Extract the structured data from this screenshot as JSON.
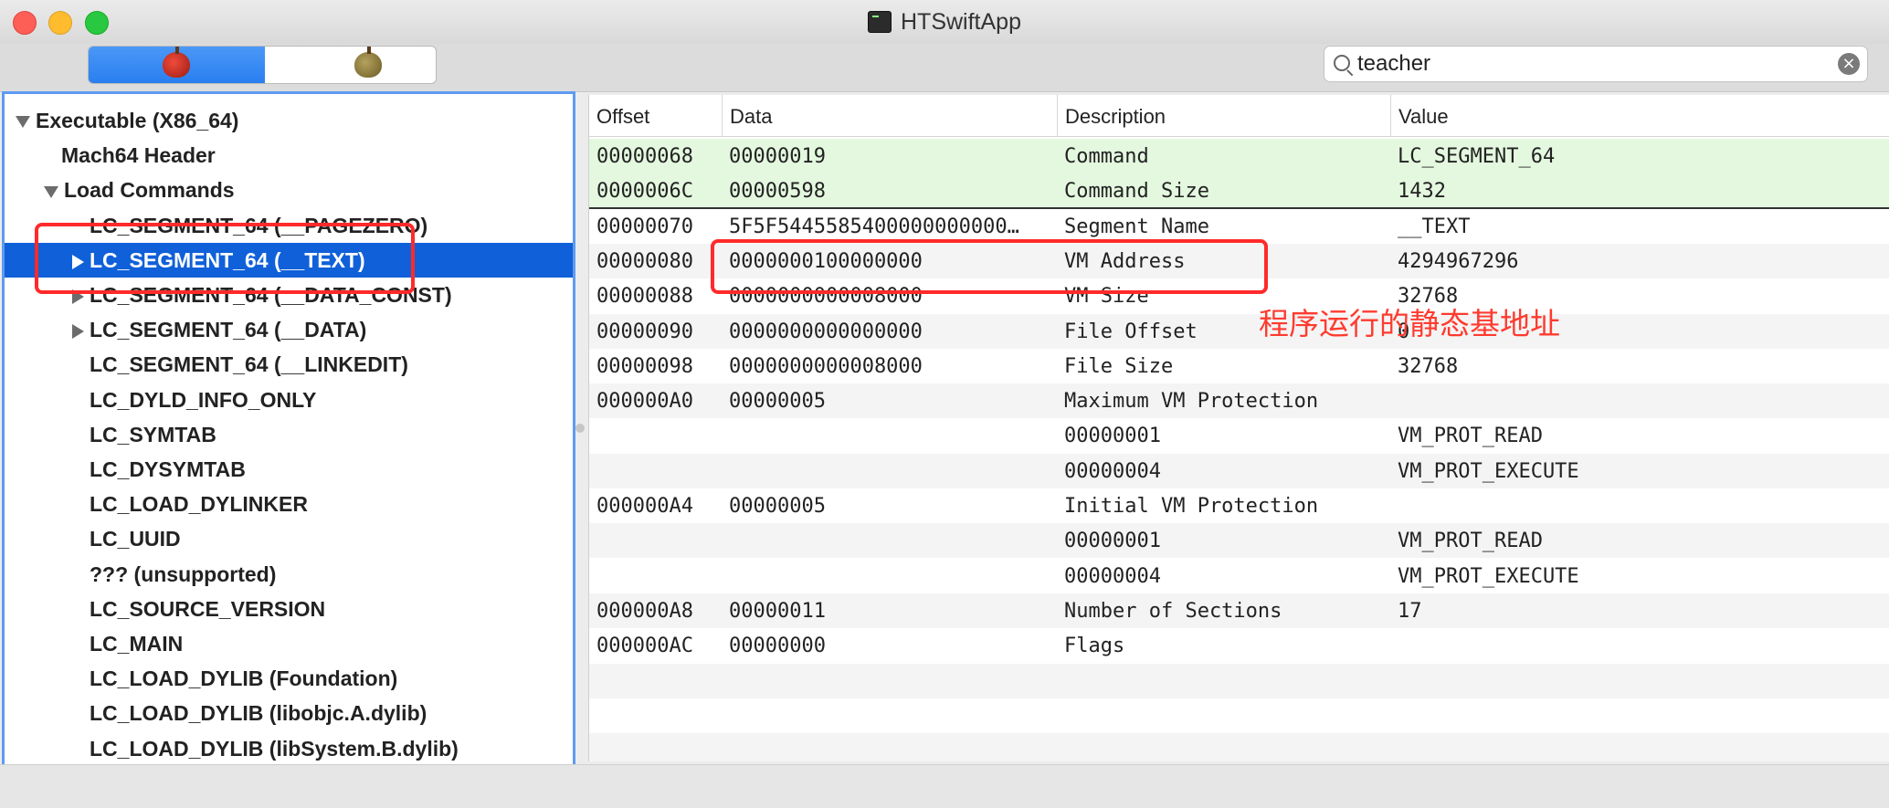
{
  "window": {
    "title": "HTSwiftApp"
  },
  "toolbar": {
    "search_value": "teacher",
    "clear_symbol": "×"
  },
  "tree": [
    {
      "label": "Executable  (X86_64)",
      "indent": 0,
      "disclosure": "down",
      "selected": false
    },
    {
      "label": "Mach64 Header",
      "indent": 1,
      "disclosure": "none",
      "selected": false
    },
    {
      "label": "Load Commands",
      "indent": 1,
      "disclosure": "down",
      "selected": false
    },
    {
      "label": "LC_SEGMENT_64 (__PAGEZERO)",
      "indent": 2,
      "disclosure": "none",
      "selected": false
    },
    {
      "label": "LC_SEGMENT_64 (__TEXT)",
      "indent": 2,
      "disclosure": "right",
      "selected": true
    },
    {
      "label": "LC_SEGMENT_64 (__DATA_CONST)",
      "indent": 2,
      "disclosure": "right",
      "selected": false
    },
    {
      "label": "LC_SEGMENT_64 (__DATA)",
      "indent": 2,
      "disclosure": "right",
      "selected": false
    },
    {
      "label": "LC_SEGMENT_64 (__LINKEDIT)",
      "indent": 2,
      "disclosure": "none",
      "selected": false
    },
    {
      "label": "LC_DYLD_INFO_ONLY",
      "indent": 2,
      "disclosure": "none",
      "selected": false
    },
    {
      "label": "LC_SYMTAB",
      "indent": 2,
      "disclosure": "none",
      "selected": false
    },
    {
      "label": "LC_DYSYMTAB",
      "indent": 2,
      "disclosure": "none",
      "selected": false
    },
    {
      "label": "LC_LOAD_DYLINKER",
      "indent": 2,
      "disclosure": "none",
      "selected": false
    },
    {
      "label": "LC_UUID",
      "indent": 2,
      "disclosure": "none",
      "selected": false
    },
    {
      "label": "??? (unsupported)",
      "indent": 2,
      "disclosure": "none",
      "selected": false
    },
    {
      "label": "LC_SOURCE_VERSION",
      "indent": 2,
      "disclosure": "none",
      "selected": false
    },
    {
      "label": "LC_MAIN",
      "indent": 2,
      "disclosure": "none",
      "selected": false
    },
    {
      "label": "LC_LOAD_DYLIB (Foundation)",
      "indent": 2,
      "disclosure": "none",
      "selected": false
    },
    {
      "label": "LC_LOAD_DYLIB (libobjc.A.dylib)",
      "indent": 2,
      "disclosure": "none",
      "selected": false
    },
    {
      "label": "LC_LOAD_DYLIB (libSystem.B.dylib)",
      "indent": 2,
      "disclosure": "none",
      "selected": false
    }
  ],
  "table": {
    "headers": [
      "Offset",
      "Data",
      "Description",
      "Value"
    ],
    "rows": [
      {
        "offset": "00000068",
        "data": "00000019",
        "desc": "Command",
        "value": "LC_SEGMENT_64",
        "style": "hl"
      },
      {
        "offset": "0000006C",
        "data": "00000598",
        "desc": "Command Size",
        "value": "1432",
        "style": "hl"
      },
      {
        "offset": "00000070",
        "data": "5F5F5445585400000000000…",
        "desc": "Segment Name",
        "value": "__TEXT",
        "style": ""
      },
      {
        "offset": "00000080",
        "data": "0000000100000000",
        "desc": "VM Address",
        "value": "4294967296",
        "style": "alt"
      },
      {
        "offset": "00000088",
        "data": "0000000000008000",
        "desc": "VM Size",
        "value": "32768",
        "style": ""
      },
      {
        "offset": "00000090",
        "data": "0000000000000000",
        "desc": "File Offset",
        "value": "0",
        "style": "alt"
      },
      {
        "offset": "00000098",
        "data": "0000000000008000",
        "desc": "File Size",
        "value": "32768",
        "style": ""
      },
      {
        "offset": "000000A0",
        "data": "00000005",
        "desc": "Maximum VM Protection",
        "value": "",
        "style": "alt"
      },
      {
        "offset": "",
        "data": "",
        "desc": "00000001",
        "value": "VM_PROT_READ",
        "style": ""
      },
      {
        "offset": "",
        "data": "",
        "desc": "00000004",
        "value": "VM_PROT_EXECUTE",
        "style": "alt"
      },
      {
        "offset": "000000A4",
        "data": "00000005",
        "desc": "Initial VM Protection",
        "value": "",
        "style": ""
      },
      {
        "offset": "",
        "data": "",
        "desc": "00000001",
        "value": "VM_PROT_READ",
        "style": "alt"
      },
      {
        "offset": "",
        "data": "",
        "desc": "00000004",
        "value": "VM_PROT_EXECUTE",
        "style": ""
      },
      {
        "offset": "000000A8",
        "data": "00000011",
        "desc": "Number of Sections",
        "value": "17",
        "style": "alt"
      },
      {
        "offset": "000000AC",
        "data": "00000000",
        "desc": "Flags",
        "value": "",
        "style": ""
      },
      {
        "offset": "",
        "data": "",
        "desc": "",
        "value": "",
        "style": "alt"
      },
      {
        "offset": "",
        "data": "",
        "desc": "",
        "value": "",
        "style": ""
      },
      {
        "offset": "",
        "data": "",
        "desc": "",
        "value": "",
        "style": "alt"
      }
    ]
  },
  "annotation": {
    "text": "程序运行的静态基地址",
    "color": "#ff3b2f"
  },
  "colors": {
    "selection": "#1060d9",
    "highlight_row": "#e4f8df",
    "annotation_box": "#ff2a2a"
  }
}
